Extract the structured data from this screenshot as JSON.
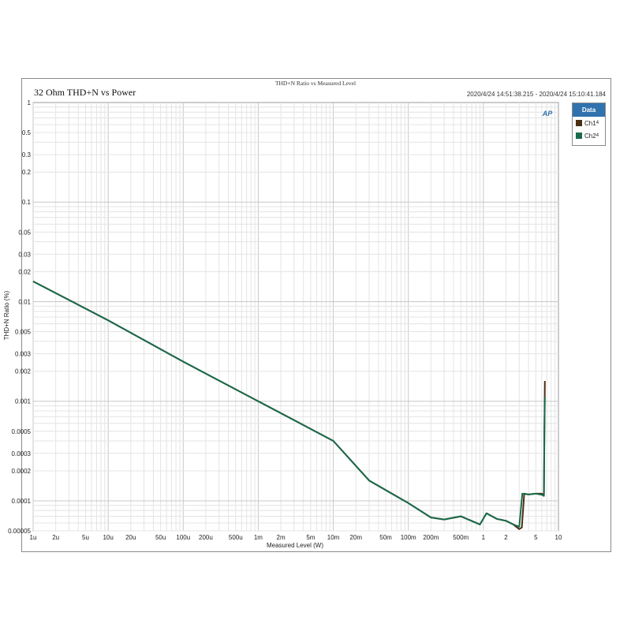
{
  "chart_data": {
    "type": "line",
    "title": "32 Ohm THD+N vs Power",
    "subtitle": "THD+N Ratio vs Measured Level",
    "timestamp": "2020/4/24 14:51:38.215 - 2020/4/24 15:10:41.184",
    "xlabel": "Measured Level (W)",
    "ylabel": "THD+N Ratio (%)",
    "xscale": "log",
    "yscale": "log",
    "xlim": [
      1e-06,
      10
    ],
    "ylim": [
      5e-05,
      1
    ],
    "grid": true,
    "legend_title": "Data",
    "legend_position": "top-right",
    "x_ticks": [
      {
        "v": 1e-06,
        "label": "1u"
      },
      {
        "v": 2e-06,
        "label": "2u"
      },
      {
        "v": 5e-06,
        "label": "5u"
      },
      {
        "v": 1e-05,
        "label": "10u"
      },
      {
        "v": 2e-05,
        "label": "20u"
      },
      {
        "v": 5e-05,
        "label": "50u"
      },
      {
        "v": 0.0001,
        "label": "100u"
      },
      {
        "v": 0.0002,
        "label": "200u"
      },
      {
        "v": 0.0005,
        "label": "500u"
      },
      {
        "v": 0.001,
        "label": "1m"
      },
      {
        "v": 0.002,
        "label": "2m"
      },
      {
        "v": 0.005,
        "label": "5m"
      },
      {
        "v": 0.01,
        "label": "10m"
      },
      {
        "v": 0.02,
        "label": "20m"
      },
      {
        "v": 0.05,
        "label": "50m"
      },
      {
        "v": 0.1,
        "label": "100m"
      },
      {
        "v": 0.2,
        "label": "200m"
      },
      {
        "v": 0.5,
        "label": "500m"
      },
      {
        "v": 1,
        "label": "1"
      },
      {
        "v": 2,
        "label": "2"
      },
      {
        "v": 5,
        "label": "5"
      },
      {
        "v": 10,
        "label": "10"
      }
    ],
    "y_ticks": [
      {
        "v": 1,
        "label": "1"
      },
      {
        "v": 0.5,
        "label": "0.5"
      },
      {
        "v": 0.3,
        "label": "0.3"
      },
      {
        "v": 0.2,
        "label": "0.2"
      },
      {
        "v": 0.1,
        "label": "0.1"
      },
      {
        "v": 0.05,
        "label": "0.05"
      },
      {
        "v": 0.03,
        "label": "0.03"
      },
      {
        "v": 0.02,
        "label": "0.02"
      },
      {
        "v": 0.01,
        "label": "0.01"
      },
      {
        "v": 0.005,
        "label": "0.005"
      },
      {
        "v": 0.003,
        "label": "0.003"
      },
      {
        "v": 0.002,
        "label": "0.002"
      },
      {
        "v": 0.001,
        "label": "0.001"
      },
      {
        "v": 0.0005,
        "label": "0.0005"
      },
      {
        "v": 0.0003,
        "label": "0.0003"
      },
      {
        "v": 0.0002,
        "label": "0.0002"
      },
      {
        "v": 0.0001,
        "label": "0.0001"
      },
      {
        "v": 5e-05,
        "label": "0.00005"
      }
    ],
    "series": [
      {
        "name": "Ch1",
        "name_sub": "4",
        "color": "#4a2e12",
        "x": [
          1e-06,
          1e-05,
          0.0001,
          0.001,
          0.01,
          0.03,
          0.1,
          0.2,
          0.3,
          0.5,
          0.9,
          1.1,
          1.5,
          2.0,
          2.5,
          3.0,
          3.25,
          3.5,
          4.0,
          5.0,
          6.0,
          6.4,
          6.5,
          6.6
        ],
        "y": [
          0.016,
          0.0065,
          0.0025,
          0.001,
          0.0004,
          0.00016,
          9.5e-05,
          6.8e-05,
          6.5e-05,
          7e-05,
          5.8e-05,
          7.5e-05,
          6.6e-05,
          6.3e-05,
          5.8e-05,
          5.2e-05,
          5.4e-05,
          0.000118,
          0.000116,
          0.000118,
          0.000118,
          0.000115,
          0.00053,
          0.0016
        ]
      },
      {
        "name": "Ch2",
        "name_sub": "4",
        "color": "#1a6b4a",
        "x": [
          1e-06,
          1e-05,
          0.0001,
          0.001,
          0.01,
          0.03,
          0.1,
          0.2,
          0.3,
          0.5,
          0.9,
          1.1,
          1.5,
          2.0,
          2.5,
          3.0,
          3.3,
          4.0,
          5.0,
          6.0,
          6.4,
          6.5,
          6.6
        ],
        "y": [
          0.016,
          0.0065,
          0.0025,
          0.001,
          0.0004,
          0.00016,
          9.5e-05,
          6.8e-05,
          6.5e-05,
          7e-05,
          5.8e-05,
          7.5e-05,
          6.6e-05,
          6.3e-05,
          5.8e-05,
          5.5e-05,
          0.000118,
          0.000116,
          0.000118,
          0.000115,
          0.000112,
          0.00048,
          0.0011
        ]
      }
    ]
  },
  "logo": {
    "text": "AP",
    "color": "#2f72ae"
  },
  "legend_header_color": "#2f72ae"
}
